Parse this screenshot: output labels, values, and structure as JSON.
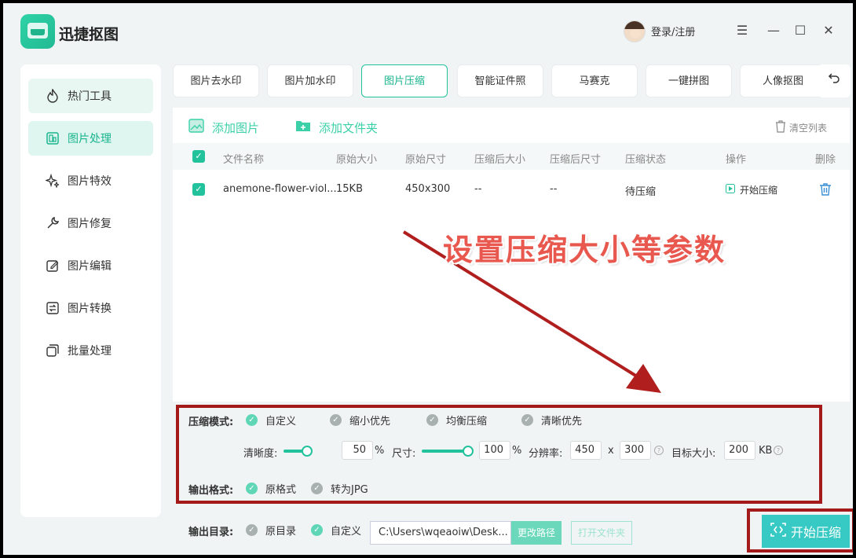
{
  "app": {
    "title": "迅捷抠图",
    "login": "登录/注册"
  },
  "sidebar": {
    "items": [
      {
        "label": "热门工具",
        "icon": "flame-icon"
      },
      {
        "label": "图片处理",
        "icon": "image-process-icon"
      },
      {
        "label": "图片特效",
        "icon": "sparkle-icon"
      },
      {
        "label": "图片修复",
        "icon": "wrench-icon"
      },
      {
        "label": "图片编辑",
        "icon": "edit-icon"
      },
      {
        "label": "图片转换",
        "icon": "convert-icon"
      },
      {
        "label": "批量处理",
        "icon": "batch-icon"
      }
    ],
    "active_index": 1
  },
  "tabs": [
    "图片去水印",
    "图片加水印",
    "图片压缩",
    "智能证件照",
    "马赛克",
    "一键拼图",
    "人像抠图"
  ],
  "toolbar": {
    "add_image": "添加图片",
    "add_folder": "添加文件夹",
    "clear_list": "清空列表"
  },
  "table": {
    "headers": [
      "文件名称",
      "原始大小",
      "原始尺寸",
      "压缩后大小",
      "压缩后尺寸",
      "压缩状态",
      "操作",
      "删除"
    ],
    "rows": [
      {
        "name": "anemone-flower-viol...",
        "size": "15KB",
        "dims": "450x300",
        "new_size": "--",
        "new_dims": "--",
        "status": "待压缩",
        "action": "开始压缩"
      }
    ]
  },
  "annotation": "设置压缩大小等参数",
  "settings": {
    "mode_label": "压缩模式:",
    "modes": [
      "自定义",
      "缩小优先",
      "均衡压缩",
      "清晰优先"
    ],
    "clarity_label": "清晰度:",
    "clarity_value": "50",
    "percent": "%",
    "size_label": "尺寸:",
    "size_value": "100",
    "resolution_label": "分辨率:",
    "res_w": "450",
    "res_x": "x",
    "res_h": "300",
    "target_label": "目标大小:",
    "target_value": "200",
    "target_unit": "KB",
    "format_label": "输出格式:",
    "formats": [
      "原格式",
      "转为JPG"
    ]
  },
  "output": {
    "label": "输出目录:",
    "options": [
      "原目录",
      "自定义"
    ],
    "path": "C:\\Users\\wqeaoiw\\Desk...",
    "change": "更改路径",
    "open": "打开文件夹",
    "start": "开始压缩"
  }
}
